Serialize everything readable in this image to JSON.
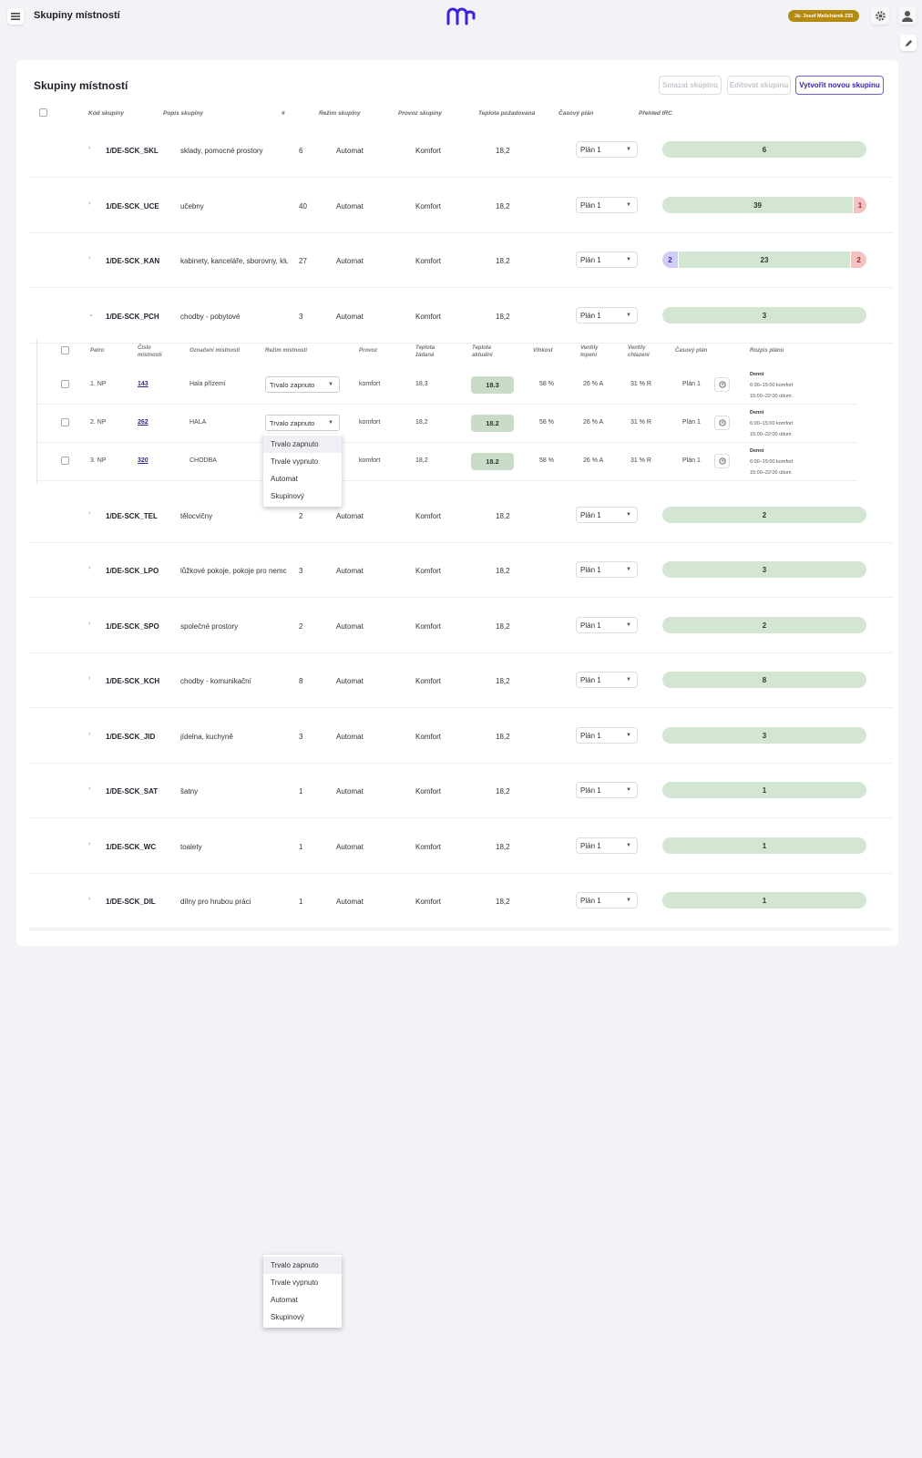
{
  "app": {
    "title": "Skupiny místností",
    "user": "Já: Josef Melichárek 233"
  },
  "card": {
    "title": "Skupiny místností",
    "buttons": {
      "delete": "Smazat skupinu",
      "edit": "Editovat skupinu",
      "create": "Vytvořit novou skupinu"
    }
  },
  "table": {
    "headers": [
      "Kód skupiny",
      "Popis skupiny",
      "#",
      "Režim skupiny",
      "Provoz skupiny",
      "Teplota požadovaná",
      "Časový plán",
      "Přehled IRC"
    ],
    "rows": [
      {
        "code": "1/DE-SCK_SKL",
        "desc": "sklady, pomocné prostory",
        "count": "6",
        "mode": "Automat",
        "provoz": "Komfort",
        "temp": "18,2",
        "plan": "Plán 1",
        "caret": "›",
        "irc": [
          {
            "k": "g",
            "v": "6",
            "n": 6
          }
        ]
      },
      {
        "code": "1/DE-SCK_UCE",
        "desc": "učebny",
        "count": "40",
        "mode": "Automat",
        "provoz": "Komfort",
        "temp": "18,2",
        "plan": "Plán 1",
        "caret": "›",
        "irc": [
          {
            "k": "g",
            "v": "39",
            "n": 39
          },
          {
            "k": "r",
            "v": "1",
            "n": 1
          }
        ]
      },
      {
        "code": "1/DE-SCK_KAN",
        "desc": "kabinety, kanceláře, sborovny, klu",
        "count": "27",
        "mode": "Automat",
        "provoz": "Komfort",
        "temp": "18,2",
        "plan": "Plán 1",
        "caret": "›",
        "irc": [
          {
            "k": "b",
            "v": "2",
            "n": 2
          },
          {
            "k": "g",
            "v": "23",
            "n": 23
          },
          {
            "k": "r",
            "v": "2",
            "n": 2
          }
        ]
      },
      {
        "code": "1/DE-SCK_PCH",
        "desc": "chodby - pobytové",
        "count": "3",
        "mode": "Automat",
        "provoz": "Komfort",
        "temp": "18,2",
        "plan": "Plán 1",
        "caret": "⌄",
        "irc": [
          {
            "k": "g",
            "v": "3",
            "n": 3
          }
        ]
      },
      {
        "code": "1/DE-SCK_TEL",
        "desc": "tělocvičny",
        "count": "2",
        "mode": "Automat",
        "provoz": "Komfort",
        "temp": "18,2",
        "plan": "Plán 1",
        "caret": "›",
        "irc": [
          {
            "k": "g",
            "v": "2",
            "n": 2
          }
        ]
      },
      {
        "code": "1/DE-SCK_LPO",
        "desc": "lůžkové pokoje, pokoje pro nemc",
        "count": "3",
        "mode": "Automat",
        "provoz": "Komfort",
        "temp": "18,2",
        "plan": "Plán 1",
        "caret": "›",
        "irc": [
          {
            "k": "g",
            "v": "3",
            "n": 3
          }
        ]
      },
      {
        "code": "1/DE-SCK_SPO",
        "desc": "společné prostory",
        "count": "2",
        "mode": "Automat",
        "provoz": "Komfort",
        "temp": "18,2",
        "plan": "Plán 1",
        "caret": "›",
        "irc": [
          {
            "k": "g",
            "v": "2",
            "n": 2
          }
        ]
      },
      {
        "code": "1/DE-SCK_KCH",
        "desc": "chodby - komunikační",
        "count": "8",
        "mode": "Automat",
        "provoz": "Komfort",
        "temp": "18,2",
        "plan": "Plán 1",
        "caret": "›",
        "irc": [
          {
            "k": "g",
            "v": "8",
            "n": 8
          }
        ]
      },
      {
        "code": "1/DE-SCK_JID",
        "desc": "jídelna, kuchyně",
        "count": "3",
        "mode": "Automat",
        "provoz": "Komfort",
        "temp": "18,2",
        "plan": "Plán 1",
        "caret": "›",
        "irc": [
          {
            "k": "g",
            "v": "3",
            "n": 3
          }
        ]
      },
      {
        "code": "1/DE-SCK_SAT",
        "desc": "šatny",
        "count": "1",
        "mode": "Automat",
        "provoz": "Komfort",
        "temp": "18,2",
        "plan": "Plán 1",
        "caret": "›",
        "irc": [
          {
            "k": "g",
            "v": "1",
            "n": 1
          }
        ]
      },
      {
        "code": "1/DE-SCK_WC",
        "desc": "toalety",
        "count": "1",
        "mode": "Automat",
        "provoz": "Komfort",
        "temp": "18,2",
        "plan": "Plán 1",
        "caret": "›",
        "irc": [
          {
            "k": "g",
            "v": "1",
            "n": 1
          }
        ]
      },
      {
        "code": "1/DE-SCK_DIL",
        "desc": "dílny pro hrubou práci",
        "count": "1",
        "mode": "Automat",
        "provoz": "Komfort",
        "temp": "18,2",
        "plan": "Plán 1",
        "caret": "›",
        "irc": [
          {
            "k": "g",
            "v": "1",
            "n": 1
          }
        ]
      }
    ]
  },
  "subtable": {
    "headers": [
      "Patro",
      "Číslo\nmístnosti",
      "Označení místnosti",
      "Režim místnosti",
      "Provoz",
      "Teplota\nžádaná",
      "Teplota\naktuální",
      "Vlhkost",
      "Ventily\ntopení",
      "Ventily\nchlazení",
      "Časový plán",
      "Rozpis plánu"
    ],
    "rows": [
      {
        "floor": "1. NP",
        "room": "143",
        "name": "Hala přízemí",
        "mode": "Trvalo zapnuto",
        "provoz": "komfort",
        "t_set": "18,3",
        "t_act": "18.3",
        "hum": "58 %",
        "heat": "26 % A",
        "cool": "31 % R",
        "plan": "Plán 1",
        "sched_title": "Denní",
        "sched1": "6:00–15:00 komfort",
        "sched2": "15:00–22:00 útlum"
      },
      {
        "floor": "2. NP",
        "room": "262",
        "name": "HALA",
        "mode": "Trvalo zapnuto",
        "provoz": "komfort",
        "t_set": "18,2",
        "t_act": "18.2",
        "hum": "58 %",
        "heat": "26 % A",
        "cool": "31 % R",
        "plan": "Plán 1",
        "sched_title": "Denní",
        "sched1": "6:00–15:00 komfort",
        "sched2": "15:00–22:00 útlum"
      },
      {
        "floor": "3. NP",
        "room": "320",
        "name": "CHODBA",
        "mode": "",
        "provoz": "komfort",
        "t_set": "18,2",
        "t_act": "18.2",
        "hum": "58 %",
        "heat": "26 % A",
        "cool": "31 % R",
        "plan": "Plán 1",
        "sched_title": "Denní",
        "sched1": "6:00–15:00 komfort",
        "sched2": "15:00–22:00 útlum"
      }
    ]
  },
  "dropdown_options": [
    "Trvalo zapnuto",
    "Trvale vypnuto",
    "Automat",
    "Skupinový"
  ],
  "colors": {
    "accent": "#3b23a8",
    "irc_ok": "#d3e6d2",
    "irc_low": "#cfcdf6",
    "irc_high": "#f4c2c2",
    "badge": "#b38a12"
  }
}
